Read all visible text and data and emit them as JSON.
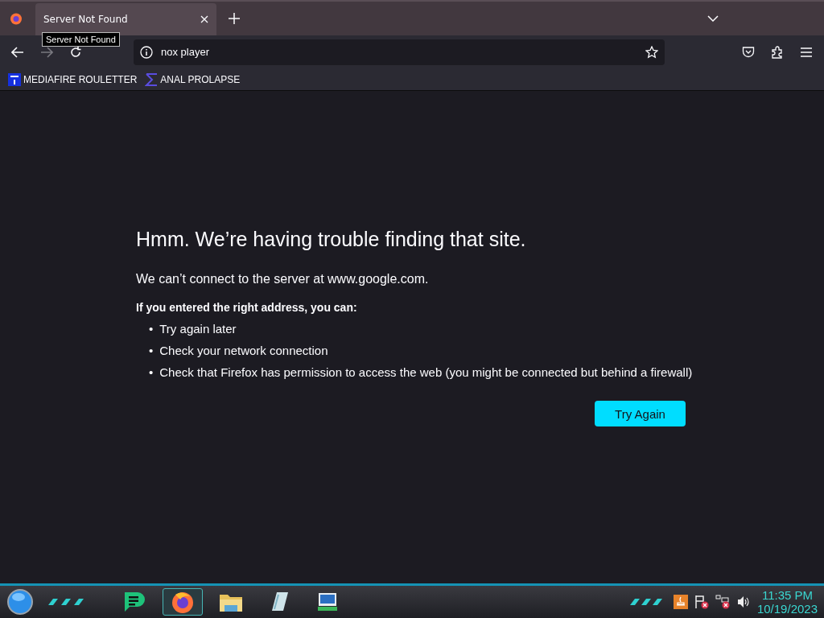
{
  "tabs": [
    {
      "label": "Server Not Found",
      "selected": true
    }
  ],
  "tooltip": "Server Not Found",
  "address_bar": {
    "value": "nox player"
  },
  "bookmarks": [
    {
      "label": "MEDIAFIRE ROULETTER",
      "kind": "mft"
    },
    {
      "label": "ANAL PROLAPSE",
      "kind": "sigma"
    }
  ],
  "error_page": {
    "title": "Hmm. We’re having trouble finding that site.",
    "message": "We can’t connect to the server at www.google.com.",
    "hint": "If you entered the right address, you can:",
    "suggestions": [
      {
        "marker": "•",
        "text": "Try again later"
      },
      {
        "marker": "•",
        "text": "Check your network connection"
      },
      {
        "marker": "•",
        "text": "Check that Firefox has permission to access the web (you might be connected but behind a firewall)"
      }
    ],
    "button": "Try Again"
  },
  "taskbar": {
    "apps": [
      {
        "kind": "chat",
        "selected": false
      },
      {
        "kind": "firefox",
        "selected": true
      },
      {
        "kind": "folder",
        "selected": false
      },
      {
        "kind": "notepad",
        "selected": false
      },
      {
        "kind": "computer",
        "selected": false
      }
    ],
    "time": "11:35 PM",
    "date": "10/19/2023"
  }
}
